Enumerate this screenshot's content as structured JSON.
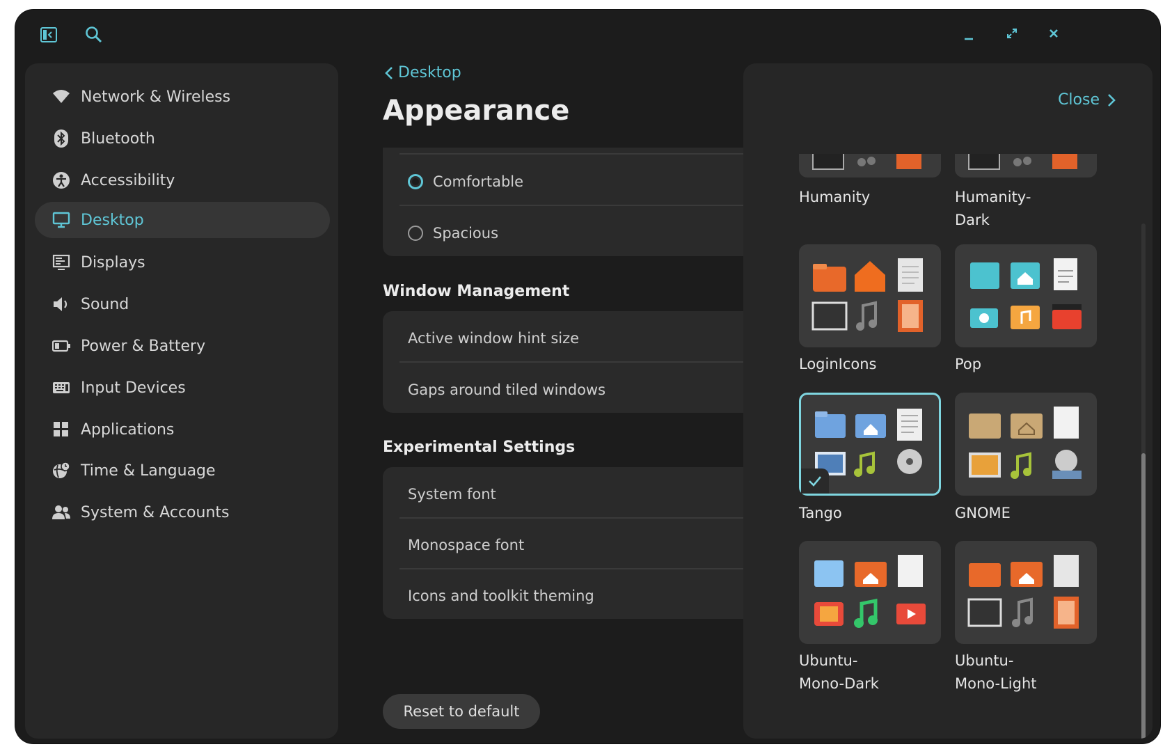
{
  "colors": {
    "accent": "#5fc6d6",
    "background": "#1c1c1c",
    "sidebar": "#272727",
    "panel": "#262626"
  },
  "header": {
    "sidebar_toggle_icon": "sidebar-toggle-icon",
    "search_icon": "search-icon",
    "minimize_icon": "minimize-icon",
    "maximize_icon": "maximize-icon",
    "close_icon": "close-icon"
  },
  "sidebar": {
    "items": [
      {
        "label": "Network & Wireless",
        "icon": "wifi-icon"
      },
      {
        "label": "Bluetooth",
        "icon": "bluetooth-icon"
      },
      {
        "label": "Accessibility",
        "icon": "accessibility-icon"
      },
      {
        "label": "Desktop",
        "icon": "monitor-icon",
        "active": true
      },
      {
        "label": "Displays",
        "icon": "display-icon"
      },
      {
        "label": "Sound",
        "icon": "speaker-icon"
      },
      {
        "label": "Power & Battery",
        "icon": "battery-icon"
      },
      {
        "label": "Input Devices",
        "icon": "keyboard-icon"
      },
      {
        "label": "Applications",
        "icon": "grid-icon"
      },
      {
        "label": "Time & Language",
        "icon": "globe-clock-icon"
      },
      {
        "label": "System & Accounts",
        "icon": "users-icon"
      }
    ]
  },
  "main": {
    "breadcrumb": "Desktop",
    "title": "Appearance",
    "density": {
      "options": [
        {
          "label": "Comfortable",
          "selected": true
        },
        {
          "label": "Spacious",
          "selected": false
        }
      ]
    },
    "window_management": {
      "heading": "Window Management",
      "rows": [
        "Active window hint size",
        "Gaps around tiled windows"
      ]
    },
    "experimental": {
      "heading": "Experimental Settings",
      "rows": [
        "System font",
        "Monospace font",
        "Icons and toolkit theming"
      ]
    },
    "reset_label": "Reset to default"
  },
  "panel": {
    "close_label": "Close",
    "themes": [
      {
        "name": "Humanity"
      },
      {
        "name": "Humanity-Dark"
      },
      {
        "name": "LoginIcons"
      },
      {
        "name": "Pop"
      },
      {
        "name": "Tango",
        "selected": true
      },
      {
        "name": "GNOME"
      },
      {
        "name": "Ubuntu-Mono-Dark"
      },
      {
        "name": "Ubuntu-Mono-Light"
      }
    ],
    "theme_labels": {
      "humanity": "Humanity",
      "humanity_dark_1": "Humanity-",
      "humanity_dark_2": "Dark",
      "loginicons": "LoginIcons",
      "pop": "Pop",
      "tango": "Tango",
      "gnome": "GNOME",
      "ubuntu_dark_1": "Ubuntu-",
      "ubuntu_dark_2": "Mono-Dark",
      "ubuntu_light_1": "Ubuntu-",
      "ubuntu_light_2": "Mono-Light"
    }
  }
}
